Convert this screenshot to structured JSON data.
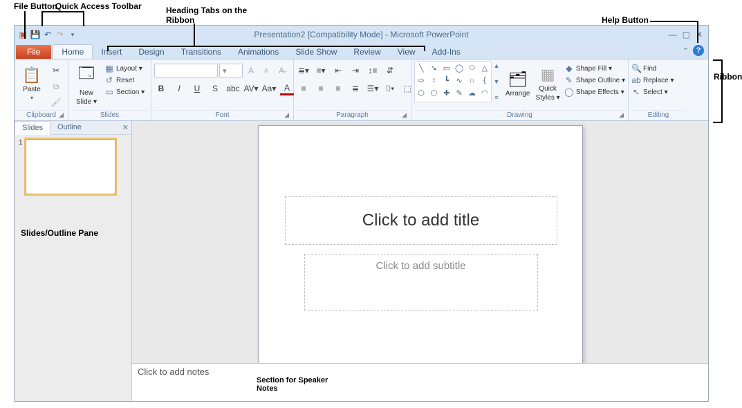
{
  "callouts": {
    "file_button": "File Button",
    "qat": "Quick Access Toolbar",
    "heading_tabs_l1": "Heading Tabs on the",
    "heading_tabs_l2": "Ribbon",
    "help": "Help Button",
    "ribbon": "Ribbon",
    "slides_pane": "Slides/Outline Pane",
    "speaker_notes_l1": "Section for Speaker",
    "speaker_notes_l2": "Notes"
  },
  "title": "Presentation2 [Compatibility Mode] - Microsoft PowerPoint",
  "tabs": {
    "file": "File",
    "home": "Home",
    "insert": "Insert",
    "design": "Design",
    "transitions": "Transitions",
    "animations": "Animations",
    "slideshow": "Slide Show",
    "review": "Review",
    "view": "View",
    "addins": "Add-Ins"
  },
  "groups": {
    "clipboard": {
      "label": "Clipboard",
      "paste": "Paste"
    },
    "slides": {
      "label": "Slides",
      "new_slide_l1": "New",
      "new_slide_l2": "Slide ▾",
      "layout": "Layout ▾",
      "reset": "Reset",
      "section": "Section ▾"
    },
    "font": {
      "label": "Font"
    },
    "paragraph": {
      "label": "Paragraph"
    },
    "drawing": {
      "label": "Drawing",
      "arrange": "Arrange",
      "quick_l1": "Quick",
      "quick_l2": "Styles ▾",
      "shape_fill": "Shape Fill ▾",
      "shape_outline": "Shape Outline ▾",
      "shape_effects": "Shape Effects ▾"
    },
    "editing": {
      "label": "Editing",
      "find": "Find",
      "replace": "Replace ▾",
      "select": "Select ▾"
    }
  },
  "pane": {
    "slides_tab": "Slides",
    "outline_tab": "Outline",
    "thumb_num": "1"
  },
  "slide": {
    "title_placeholder": "Click to add title",
    "subtitle_placeholder": "Click to add subtitle"
  },
  "notes": {
    "placeholder": "Click to add notes"
  }
}
